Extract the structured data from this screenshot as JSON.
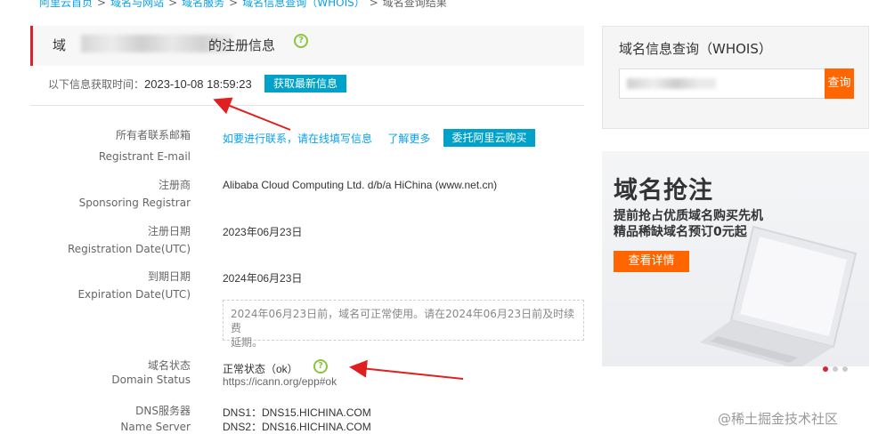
{
  "breadcrumb": {
    "items": [
      "阿里云首页",
      "域名与网站",
      "域名服务",
      "域名信息查询（WHOIS）"
    ],
    "current": "域名查询结果",
    "separator": ">"
  },
  "header": {
    "title_prefix": "域",
    "title_suffix": "的注册信息",
    "help_glyph": "?",
    "fetch_label": "以下信息获取时间：",
    "fetch_time": "2023-10-08 18:59:23",
    "refresh_label": "获取最新信息"
  },
  "rows": {
    "email": {
      "label_cn": "所有者联系邮箱",
      "label_en": "Registrant E-mail",
      "contact_link": "如要进行联系，请在线填写信息",
      "learn_more": "了解更多",
      "buy_button": "委托阿里云购买"
    },
    "registrar": {
      "label_cn": "注册商",
      "label_en": "Sponsoring Registrar",
      "value": "Alibaba Cloud Computing Ltd. d/b/a HiChina (www.net.cn)"
    },
    "registration": {
      "label_cn": "注册日期",
      "label_en": "Registration Date(UTC)",
      "value": "2023年06月23日"
    },
    "expiration": {
      "label_cn": "到期日期",
      "label_en": "Expiration Date(UTC)",
      "value": "2024年06月23日",
      "notice_line1": "2024年06月23日前，域名可正常使用。请在2024年06月23日前及时续费",
      "notice_line2": "延期。"
    },
    "status": {
      "label_cn": "域名状态",
      "label_en": "Domain Status",
      "value": "正常状态（ok）",
      "link": "https://icann.org/epp#ok"
    },
    "dns": {
      "label_cn": "DNS服务器",
      "label_en": "Name Server",
      "dns1": "DNS1：DNS15.HICHINA.COM",
      "dns2": "DNS2：DNS16.HICHINA.COM"
    }
  },
  "sidebar": {
    "whois_title": "域名信息查询（WHOIS）",
    "search_button": "查询",
    "banner": {
      "title": "域名抢注",
      "line1": "提前抢占优质域名购买先机",
      "line2": "精品稀缺域名预订0元起",
      "button": "查看详情"
    },
    "carousel": {
      "count": 3,
      "active": 0
    }
  },
  "watermark": "@稀土掘金技术社区",
  "colors": {
    "link": "#0aa1ed",
    "primary_button": "#00a2ca",
    "accent_orange": "#ff6600",
    "accent_red": "#d9232d",
    "help_green": "#8bc53f"
  }
}
